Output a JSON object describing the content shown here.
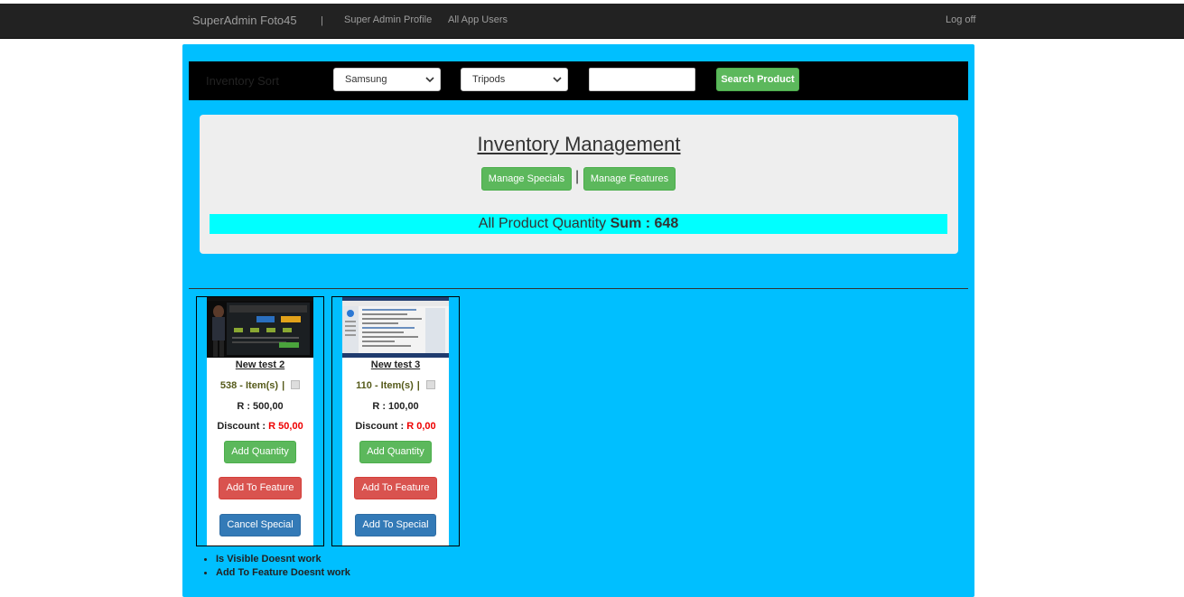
{
  "navbar": {
    "brand": "SuperAdmin Foto45",
    "separator": "|",
    "links": [
      "Super Admin Profile",
      "All App Users"
    ],
    "logoff": "Log off"
  },
  "filter": {
    "title": "Inventory Sort",
    "brand_select": "Samsung",
    "category_select": "Tripods",
    "search_value": "",
    "search_button": "Search Product"
  },
  "inventory": {
    "title": "Inventory Management",
    "manage_specials": "Manage Specials",
    "pipe": "|",
    "manage_features": "Manage Features",
    "sum_label": "All Product Quantity",
    "sum_value": "Sum : 648"
  },
  "products": [
    {
      "name": "New test 2",
      "quantity": "538 - Item(s)",
      "pipe": "|",
      "price": "R : 500,00",
      "discount_label": "Discount :",
      "discount_value": "R 50,00",
      "add_quantity": "Add Quantity",
      "feature_button": "Add To Feature",
      "special_button": "Cancel Special"
    },
    {
      "name": "New test 3",
      "quantity": "110 - Item(s)",
      "pipe": "|",
      "price": "R : 100,00",
      "discount_label": "Discount :",
      "discount_value": "R 0,00",
      "add_quantity": "Add Quantity",
      "feature_button": "Add To Feature",
      "special_button": "Add To Special"
    }
  ],
  "notes": [
    "Is Visible Doesnt work",
    "Add To Feature Doesnt work"
  ],
  "colors": {
    "navbar_bg": "#222222",
    "panel_bg": "#00bfff",
    "sum_bg": "#00ffff",
    "success": "#5cb85c",
    "danger": "#d9534f",
    "primary": "#337ab7"
  },
  "icons": {
    "select_arrow": "chevron-down-icon"
  }
}
